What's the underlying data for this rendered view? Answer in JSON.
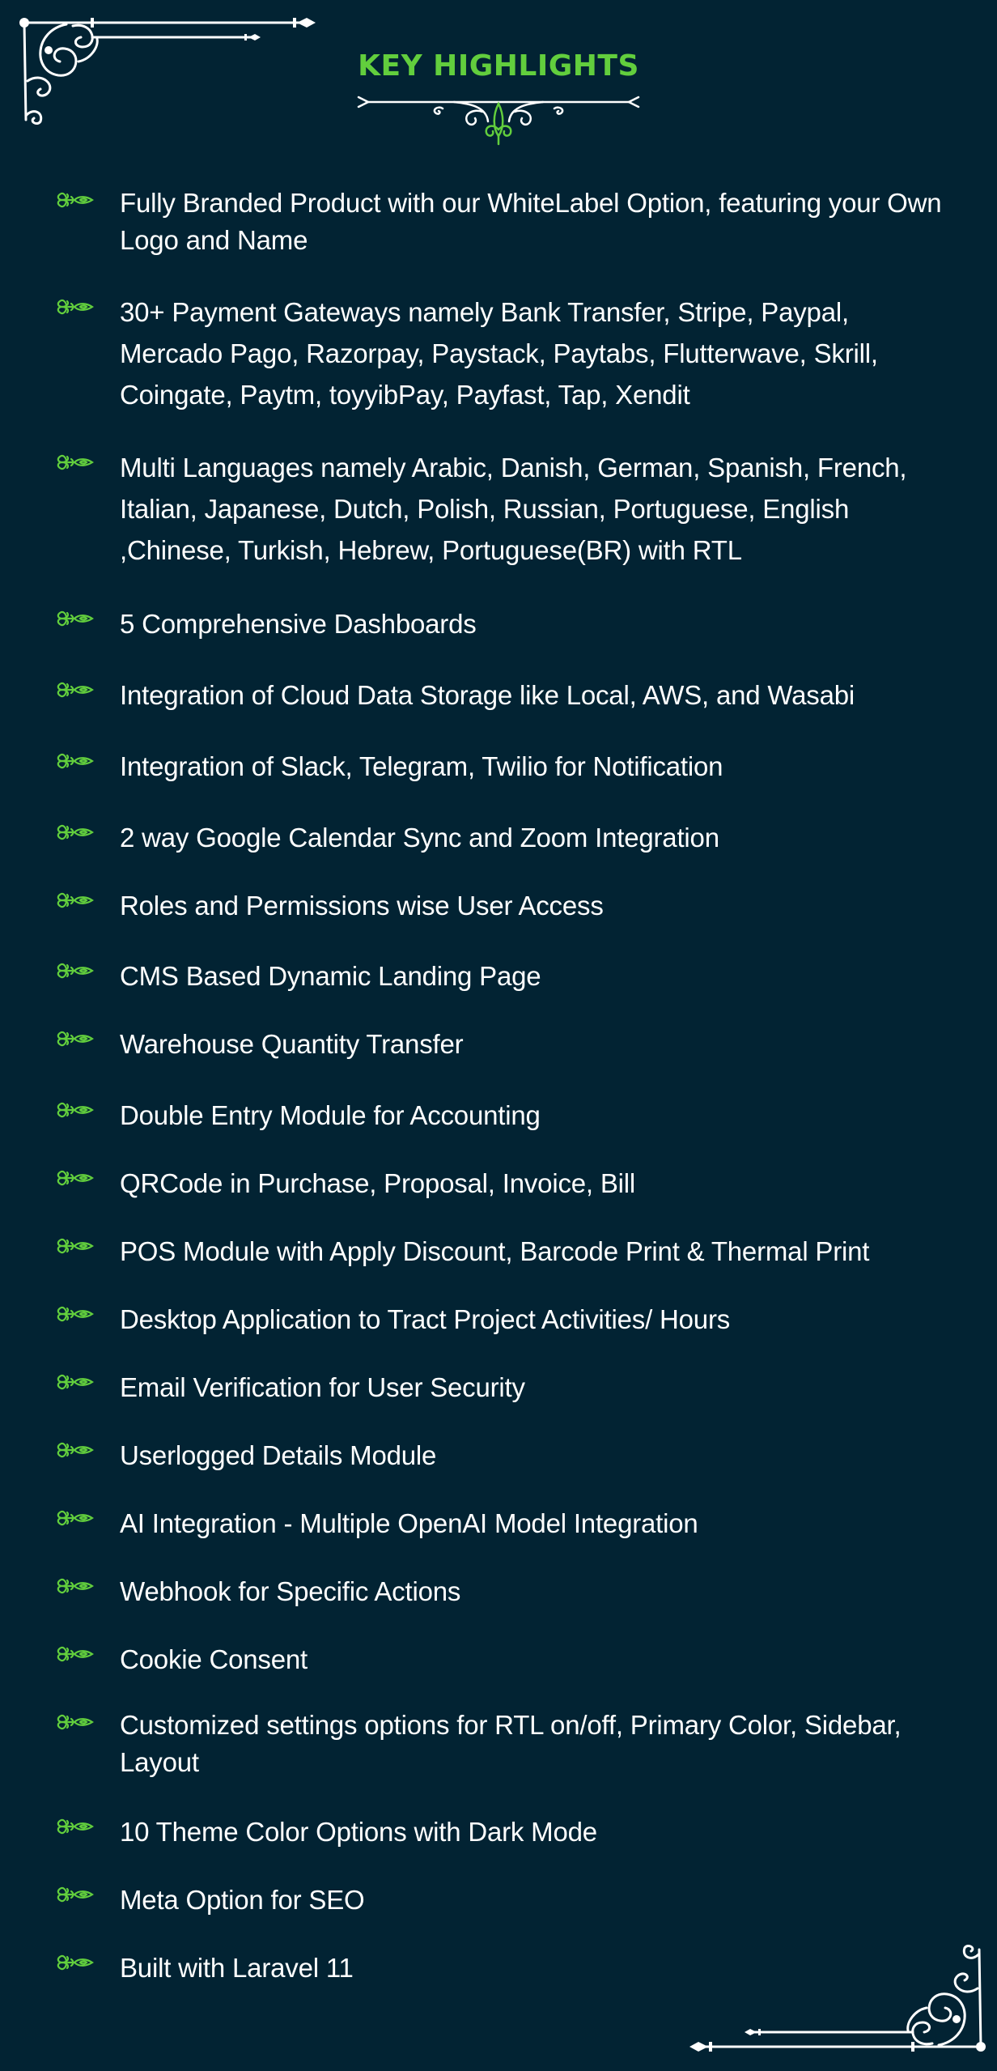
{
  "header": {
    "title": "KEY HIGHLIGHTS"
  },
  "colors": {
    "background": "#022333",
    "accent": "#62ce3d",
    "text": "#ffffff",
    "ornament": "#ffffff"
  },
  "icons": {
    "bullet": "ornamental-heart-bullet-icon",
    "title_divider": "fleur-de-lis-divider-icon",
    "corner_top_left": "scroll-corner-ornament-icon",
    "corner_bottom_right": "scroll-corner-ornament-icon"
  },
  "highlights": [
    {
      "text": "Fully Branded Product with our WhiteLabel Option, featuring your Own Logo and Name"
    },
    {
      "text": "30+ Payment Gateways namely Bank Transfer, Stripe, Paypal, Mercado Pago, Razorpay, Paystack, Paytabs, Flutterwave, Skrill, Coingate, Paytm, toyyibPay, Payfast, Tap, Xendit"
    },
    {
      "text": "Multi Languages namely Arabic, Danish, German, Spanish, French, Italian, Japanese, Dutch, Polish, Russian, Portuguese, English ,Chinese, Turkish, Hebrew, Portuguese(BR) with RTL"
    },
    {
      "text": "5 Comprehensive Dashboards"
    },
    {
      "text": "Integration of Cloud Data Storage like Local, AWS, and Wasabi"
    },
    {
      "text": "Integration of Slack, Telegram, Twilio for Notification"
    },
    {
      "text": "2 way Google Calendar Sync and Zoom Integration"
    },
    {
      "text": "Roles and Permissions wise User Access"
    },
    {
      "text": "CMS Based Dynamic Landing Page"
    },
    {
      "text": "Warehouse Quantity Transfer"
    },
    {
      "text": "Double Entry Module for Accounting"
    },
    {
      "text": "QRCode in Purchase, Proposal, Invoice, Bill"
    },
    {
      "text": "POS Module with Apply Discount, Barcode Print & Thermal Print"
    },
    {
      "text": "Desktop Application to Tract Project Activities/ Hours"
    },
    {
      "text": "Email Verification for User Security"
    },
    {
      "text": "Userlogged Details Module"
    },
    {
      "text": "AI Integration - Multiple OpenAI Model Integration"
    },
    {
      "text": "Webhook for Specific Actions"
    },
    {
      "text": "Cookie Consent"
    },
    {
      "text": "Customized settings options for RTL on/off, Primary Color, Sidebar, Layout"
    },
    {
      "text": "10 Theme Color Options with Dark Mode"
    },
    {
      "text": "Meta Option for SEO"
    },
    {
      "text": "Built with Laravel 11"
    }
  ]
}
